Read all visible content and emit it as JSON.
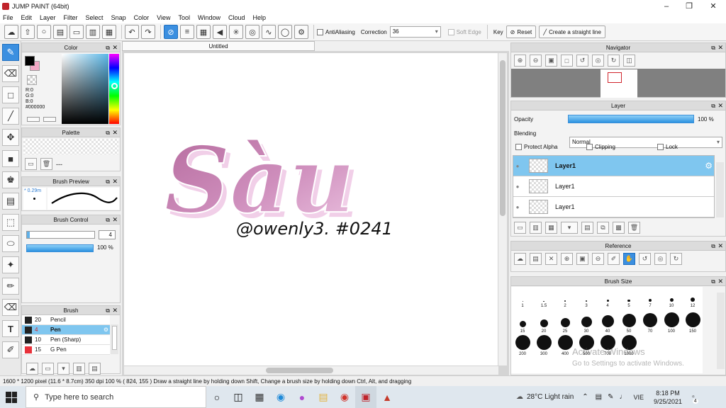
{
  "window": {
    "title": "JUMP PAINT (64bit)"
  },
  "menu": [
    "File",
    "Edit",
    "Layer",
    "Filter",
    "Select",
    "Snap",
    "Color",
    "View",
    "Tool",
    "Window",
    "Cloud",
    "Help"
  ],
  "toolbar": {
    "antialiasing_label": "AntiAliasing",
    "correction_label": "Correction",
    "correction_value": "36",
    "soft_edge_label": "Soft Edge",
    "key_label": "Key",
    "reset_label": "Reset",
    "straight_line_label": "Create a straight line"
  },
  "document": {
    "tab_title": "Untitled"
  },
  "color_panel": {
    "title": "Color",
    "r": "R:0",
    "g": "G:0",
    "b": "B:0",
    "hex": "#000000",
    "fg": "#000000",
    "bg": "#f2a7c4"
  },
  "palette_panel": {
    "title": "Palette",
    "value": "---"
  },
  "brush_preview": {
    "title": "Brush Preview",
    "size": "0.29m"
  },
  "brush_control": {
    "title": "Brush Control",
    "size_value": "4",
    "opacity_value": "100 %"
  },
  "brush_panel": {
    "title": "Brush",
    "items": [
      {
        "size": "20",
        "name": "Pencil",
        "color": "#222222",
        "selected": false
      },
      {
        "size": "4",
        "name": "Pen",
        "color": "#222222",
        "selected": true
      },
      {
        "size": "10",
        "name": "Pen (Sharp)",
        "color": "#222222",
        "selected": false
      },
      {
        "size": "15",
        "name": "G Pen",
        "color": "#e8313a",
        "selected": false
      }
    ]
  },
  "navigator": {
    "title": "Navigator"
  },
  "layer_panel": {
    "title": "Layer",
    "opacity_label": "Opacity",
    "opacity_value": "100 %",
    "blending_label": "Blending",
    "blending_value": "Normal",
    "protect_alpha_label": "Protect Alpha",
    "clipping_label": "Clipping",
    "lock_label": "Lock",
    "layers": [
      {
        "name": "Layer1",
        "selected": true
      },
      {
        "name": "Layer1",
        "selected": false
      },
      {
        "name": "Layer1",
        "selected": false
      }
    ]
  },
  "reference_panel": {
    "title": "Reference"
  },
  "brush_size_panel": {
    "title": "Brush Size",
    "sizes": [
      "1",
      "1.5",
      "2",
      "3",
      "4",
      "5",
      "7",
      "10",
      "12",
      "15",
      "20",
      "25",
      "30",
      "40",
      "50",
      "70",
      "100",
      "150",
      "200",
      "300",
      "400",
      "500",
      "700",
      "1000"
    ],
    "watermark_1": "Activate Windows",
    "watermark_2": "Go to Settings to activate Windows."
  },
  "artwork": {
    "title_text": "Sàu",
    "signature": "@owenly3. #0241"
  },
  "status": {
    "text": "1600 * 1200 pixel  (11.6 * 8.7cm)  350 dpi  100 %  ( 824, 155 )  Draw a straight line by holding down Shift, Change a brush size by holding down Ctrl, Alt, and dragging"
  },
  "taskbar": {
    "search_placeholder": "Type here to search",
    "weather": "28°C  Light rain",
    "lang": "VIE",
    "time": "8:18 PM",
    "date": "9/25/2021",
    "notifications": "4"
  }
}
